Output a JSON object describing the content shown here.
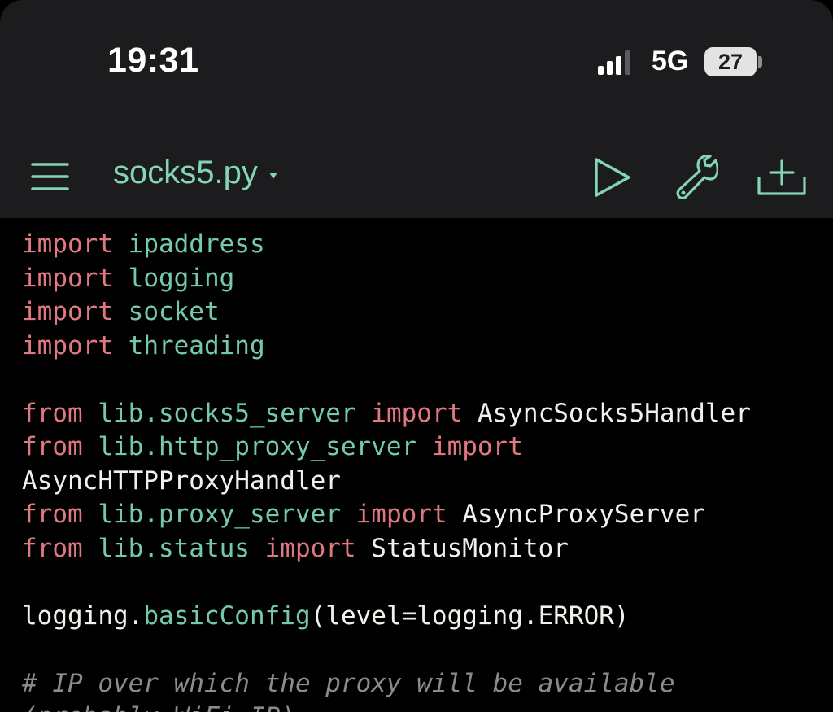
{
  "status_bar": {
    "time": "19:31",
    "network": "5G",
    "battery": "27"
  },
  "toolbar": {
    "file_name": "socks5.py"
  },
  "icons": {
    "menu": "hamburger-menu-icon",
    "dropdown": "caret-down-icon",
    "run": "play-icon",
    "settings": "wrench-icon",
    "export": "export-icon"
  },
  "colors": {
    "accent": "#84d5b3",
    "keyword": "#e07880",
    "identifier": "#74c9ad",
    "text": "#f1f1ec",
    "comment": "#8b8b8b",
    "toolbar_bg": "#1c1b1d",
    "editor_bg": "#000000"
  },
  "code": {
    "l1": {
      "kw": "import",
      "mod": "ipaddress"
    },
    "l2": {
      "kw": "import",
      "mod": "logging"
    },
    "l3": {
      "kw": "import",
      "mod": "socket"
    },
    "l4": {
      "kw": "import",
      "mod": "threading"
    },
    "l6": {
      "kw1": "from",
      "mod": "lib.socks5_server",
      "kw2": "import",
      "name": "AsyncSocks5Handler"
    },
    "l7": {
      "kw1": "from",
      "mod": "lib.http_proxy_server",
      "kw2": "import"
    },
    "l8": {
      "name": "AsyncHTTPProxyHandler"
    },
    "l9": {
      "kw1": "from",
      "mod": "lib.proxy_server",
      "kw2": "import",
      "name": "AsyncProxyServer"
    },
    "l10": {
      "kw1": "from",
      "mod": "lib.status",
      "kw2": "import",
      "name": "StatusMonitor"
    },
    "l12": {
      "obj": "logging.",
      "fn": "basicConfig",
      "args": "(level=logging.ERROR)"
    },
    "l14": {
      "comment": "# IP over which the proxy will be available"
    },
    "l15": {
      "comment": "(probably WiFi IP)"
    }
  }
}
